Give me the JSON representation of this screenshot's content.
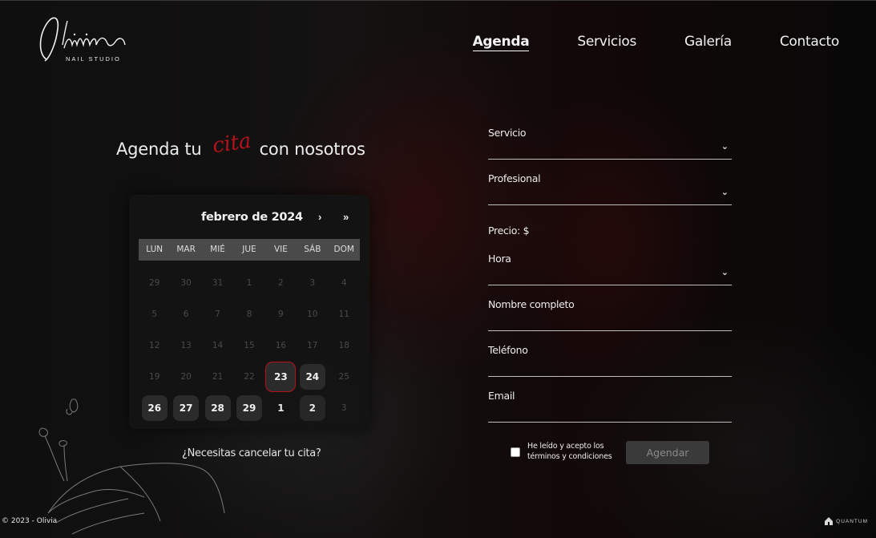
{
  "brand": {
    "logo_text": "Olivia",
    "logo_sub": "NAIL STUDIO"
  },
  "nav": {
    "items": [
      {
        "label": "Agenda",
        "active": true
      },
      {
        "label": "Servicios",
        "active": false
      },
      {
        "label": "Galería",
        "active": false
      },
      {
        "label": "Contacto",
        "active": false
      }
    ]
  },
  "hero": {
    "heading_pre": "Agenda tu",
    "heading_script": "cita",
    "heading_post": "con nosotros"
  },
  "calendar": {
    "month_label": "febrero de 2024",
    "next_label": "›",
    "next_year_label": "»",
    "weekdays": [
      "LUN",
      "MAR",
      "MIÉ",
      "JUE",
      "VIE",
      "SÁB",
      "DOM"
    ],
    "weeks": [
      [
        {
          "d": "29",
          "s": "muted"
        },
        {
          "d": "30",
          "s": "muted"
        },
        {
          "d": "31",
          "s": "muted"
        },
        {
          "d": "1",
          "s": "muted"
        },
        {
          "d": "2",
          "s": "muted"
        },
        {
          "d": "3",
          "s": "muted"
        },
        {
          "d": "4",
          "s": "muted"
        }
      ],
      [
        {
          "d": "5",
          "s": "muted"
        },
        {
          "d": "6",
          "s": "muted"
        },
        {
          "d": "7",
          "s": "muted"
        },
        {
          "d": "8",
          "s": "muted"
        },
        {
          "d": "9",
          "s": "muted"
        },
        {
          "d": "10",
          "s": "muted"
        },
        {
          "d": "11",
          "s": "muted"
        }
      ],
      [
        {
          "d": "12",
          "s": "muted"
        },
        {
          "d": "13",
          "s": "muted"
        },
        {
          "d": "14",
          "s": "muted"
        },
        {
          "d": "15",
          "s": "muted"
        },
        {
          "d": "16",
          "s": "muted"
        },
        {
          "d": "17",
          "s": "muted"
        },
        {
          "d": "18",
          "s": "muted"
        }
      ],
      [
        {
          "d": "19",
          "s": "muted"
        },
        {
          "d": "20",
          "s": "muted"
        },
        {
          "d": "21",
          "s": "muted"
        },
        {
          "d": "22",
          "s": "muted"
        },
        {
          "d": "23",
          "s": "selected"
        },
        {
          "d": "24",
          "s": "avail"
        },
        {
          "d": "25",
          "s": "muted"
        }
      ],
      [
        {
          "d": "26",
          "s": "avail"
        },
        {
          "d": "27",
          "s": "avail"
        },
        {
          "d": "28",
          "s": "avail"
        },
        {
          "d": "29",
          "s": "avail"
        },
        {
          "d": "1",
          "s": "next"
        },
        {
          "d": "2",
          "s": "next avail"
        },
        {
          "d": "3",
          "s": "muted"
        }
      ]
    ],
    "selected_color": "#b3121b"
  },
  "cancel_link": "¿Necesitas cancelar tu cita?",
  "form": {
    "servicio_label": "Servicio",
    "profesional_label": "Profesional",
    "precio_label": "Precio: $",
    "hora_label": "Hora",
    "nombre_label": "Nombre completo",
    "telefono_label": "Teléfono",
    "email_label": "Email",
    "terms_line1": "He leído y acepto los",
    "terms_line2": "términos y condiciones",
    "submit_label": "Agendar"
  },
  "footer": {
    "copyright": "© 2023 - Olivia",
    "credit": "QUANTUM"
  }
}
